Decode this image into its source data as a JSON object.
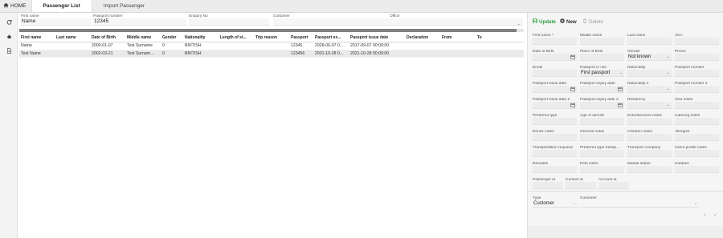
{
  "nav": {
    "home_label": "HOME",
    "tabs": [
      {
        "label": "Passenger List",
        "active": true
      },
      {
        "label": "Import Passenger",
        "active": false
      }
    ]
  },
  "filters": {
    "first_name": {
      "label": "First name",
      "value": "Name"
    },
    "passport_number": {
      "label": "Passport number",
      "value": "12345"
    },
    "enquiry_no": {
      "label": "Enquiry No",
      "value": ""
    },
    "customer": {
      "label": "Customer",
      "value": ""
    },
    "office": {
      "label": "Office",
      "value": ""
    }
  },
  "progress_fraction": 0.985,
  "table": {
    "columns": [
      "First name",
      "Last name",
      "Date of Birth",
      "Middle name",
      "Gender",
      "Nationality",
      "Length of st...",
      "Trip reason",
      "Passport",
      "Passport ex...",
      "Passport issue date",
      "Declaration",
      "From",
      "To"
    ],
    "rows": [
      [
        "Name",
        "",
        "2000-01-07",
        "Test Surname",
        "0",
        "BRITISH",
        "",
        "",
        "12345",
        "2028-06-07 0...",
        "2017-09-07 00:00:00",
        "",
        "",
        ""
      ],
      [
        "Test Name",
        "",
        "2002-03-21",
        "Test Surnam...",
        "0",
        "BRITISH",
        "",
        "",
        "123456",
        "2031-10-28 0...",
        "2021-10-28 00:00:00",
        "",
        "",
        ""
      ]
    ]
  },
  "toolbar": {
    "update_label": "Update",
    "new_label": "New",
    "delete_label": "Delete"
  },
  "form": {
    "first_name": {
      "label": "First name *",
      "value": ""
    },
    "middle_name": {
      "label": "Middle name",
      "value": ""
    },
    "last_name": {
      "label": "Last name",
      "value": ""
    },
    "aka": {
      "label": "AKA",
      "value": ""
    },
    "date_of_birth": {
      "label": "Date of Birth",
      "value": ""
    },
    "place_of_birth": {
      "label": "Place of Birth",
      "value": ""
    },
    "gender": {
      "label": "Gender",
      "value": "Not known"
    },
    "phone": {
      "label": "Phone",
      "value": ""
    },
    "email": {
      "label": "Email",
      "value": ""
    },
    "passport_in_use": {
      "label": "Passport in use",
      "value": "First passport"
    },
    "nationality": {
      "label": "Nationality",
      "value": ""
    },
    "passport_number": {
      "label": "Passport number",
      "value": ""
    },
    "passport_issue_date": {
      "label": "Passport issue date",
      "value": ""
    },
    "passport_expiry_date": {
      "label": "Passport expiry date",
      "value": ""
    },
    "nationality_2": {
      "label": "Nationality 2",
      "value": ""
    },
    "passport_number_2": {
      "label": "Passport number 2",
      "value": ""
    },
    "passport_issue_date_2": {
      "label": "Passport issue date 2",
      "value": ""
    },
    "passport_expiry_date_2": {
      "label": "Passport expiry date 2",
      "value": ""
    },
    "residency": {
      "label": "Residency",
      "value": ""
    },
    "visa_notes": {
      "label": "Visa notes",
      "value": ""
    },
    "preferred_type": {
      "label": "Preferred type",
      "value": ""
    },
    "age_of_aircraft": {
      "label": "Age of aircraft",
      "value": ""
    },
    "entertainment_notes": {
      "label": "Entertainment notes",
      "value": ""
    },
    "catering_notes": {
      "label": "Catering notes",
      "value": ""
    },
    "drinks_notes": {
      "label": "Drinks notes",
      "value": ""
    },
    "general_notes": {
      "label": "General notes",
      "value": ""
    },
    "children_notes": {
      "label": "Children notes",
      "value": ""
    },
    "allergies": {
      "label": "Allergies",
      "value": ""
    },
    "transportation_required": {
      "label": "Transportation required",
      "value": ""
    },
    "preferred_type_transport": {
      "label": "Preferred type transp...",
      "value": ""
    },
    "transport_company": {
      "label": "Transport company",
      "value": ""
    },
    "client_profile_notes": {
      "label": "Client profile notes",
      "value": ""
    },
    "remarks": {
      "label": "Remarks",
      "value": ""
    },
    "pets_notes": {
      "label": "Pets notes",
      "value": ""
    },
    "marital_status": {
      "label": "Marital status",
      "value": ""
    },
    "hobbies": {
      "label": "Hobbies",
      "value": ""
    },
    "passenger_id": {
      "label": "Passenger id",
      "value": ""
    },
    "contact_id": {
      "label": "Contact id",
      "value": ""
    },
    "account_id": {
      "label": "Account id",
      "value": ""
    }
  },
  "link": {
    "type": {
      "label": "Type",
      "value": "Customer"
    },
    "customer": {
      "label": "Customer",
      "value": ""
    }
  },
  "colors": {
    "update_green": "#2e9e3e",
    "new_dark": "#333333",
    "delete_grey": "#9a9a9a"
  }
}
